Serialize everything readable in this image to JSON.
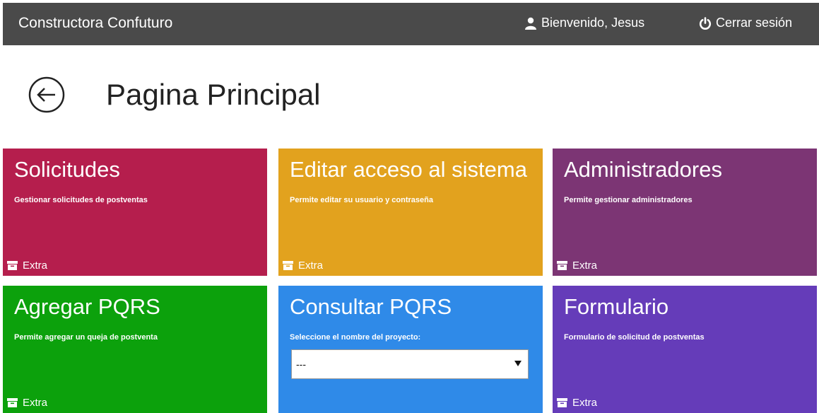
{
  "header": {
    "brand": "Constructora Confuturo",
    "welcome": "Bienvenido, Jesus",
    "logout": "Cerrar sesión",
    "background": "#4a4a4a"
  },
  "page": {
    "title": "Pagina Principal"
  },
  "tiles": [
    {
      "title": "Solicitudes",
      "description": "Gestionar solicitudes de postventas",
      "footer": "Extra",
      "color": "#b51e4d"
    },
    {
      "title": "Editar acceso al sistema",
      "description": "Permite editar su usuario y contraseña",
      "footer": "Extra",
      "color": "#e2a21e"
    },
    {
      "title": "Administradores",
      "description": "Permite gestionar administradores",
      "footer": "Extra",
      "color": "#7c3574"
    },
    {
      "title": "Agregar PQRS",
      "description": "Permite agregar un queja de postventa",
      "footer": "Extra",
      "color": "#0ca10c"
    },
    {
      "title": "Consultar PQRS",
      "description": "Seleccione el nombre del proyecto:",
      "select_value": "---",
      "color": "#2f8ae8"
    },
    {
      "title": "Formulario",
      "description": "Formulario de solicitud de postventas",
      "footer": "Extra",
      "color": "#653cb9"
    }
  ],
  "icons": {
    "user": "user-icon",
    "power": "power-icon",
    "back": "back-arrow-icon",
    "archive": "archive-icon",
    "dropdown": "chevron-down-icon"
  }
}
